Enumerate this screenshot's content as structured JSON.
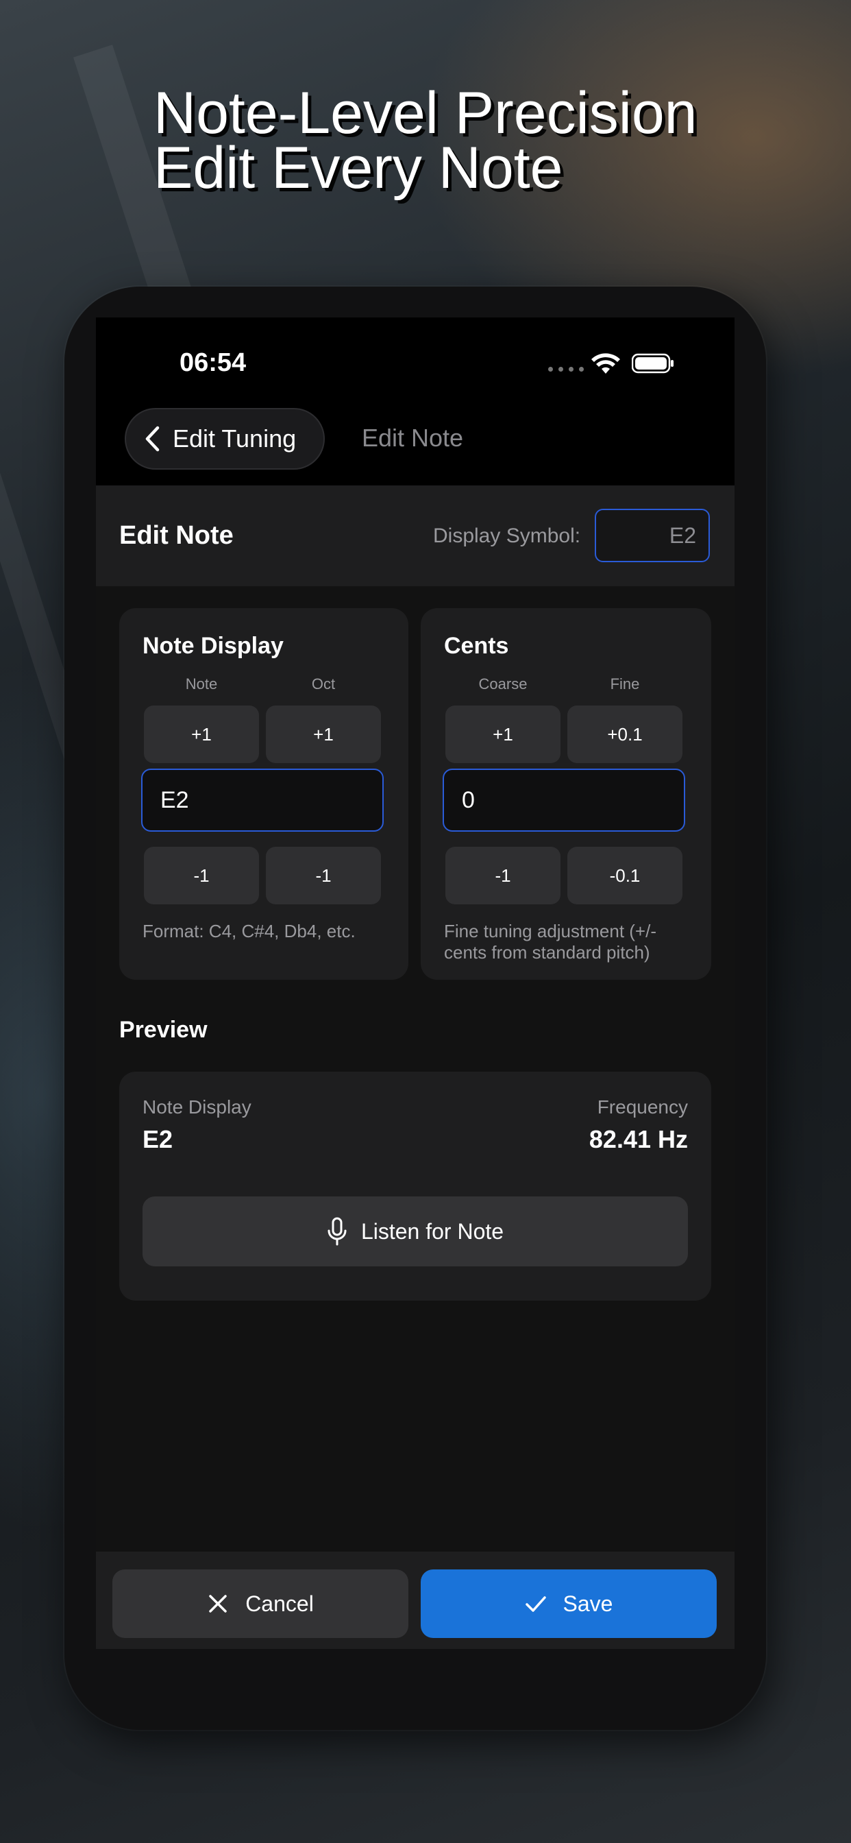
{
  "hero": {
    "line1": "Note-Level Precision",
    "line2": "Edit Every Note"
  },
  "status_bar": {
    "time": "06:54"
  },
  "nav": {
    "back_label": "Edit Tuning",
    "title": "Edit Note"
  },
  "header": {
    "title": "Edit Note",
    "display_symbol_label": "Display Symbol:",
    "display_symbol_placeholder": "E2"
  },
  "note_display": {
    "title": "Note Display",
    "col_note": "Note",
    "col_oct": "Oct",
    "note_plus": "+1",
    "oct_plus": "+1",
    "value": "E2",
    "note_minus": "-1",
    "oct_minus": "-1",
    "help": "Format: C4, C#4, Db4, etc."
  },
  "cents": {
    "title": "Cents",
    "col_coarse": "Coarse",
    "col_fine": "Fine",
    "coarse_plus": "+1",
    "fine_plus": "+0.1",
    "value": "0",
    "coarse_minus": "-1",
    "fine_minus": "-0.1",
    "help": "Fine tuning adjustment (+/- cents from standard pitch)"
  },
  "preview": {
    "section_title": "Preview",
    "note_label": "Note Display",
    "note_value": "E2",
    "freq_label": "Frequency",
    "freq_value": "82.41 Hz",
    "listen_label": "Listen for Note"
  },
  "actions": {
    "cancel_label": "Cancel",
    "save_label": "Save"
  },
  "colors": {
    "accent": "#1a73d9",
    "focus_border": "#2a5bd7"
  },
  "icons": {
    "back": "chevron-left-icon",
    "mic": "microphone-icon",
    "cancel": "close-icon",
    "save": "checkmark-icon",
    "wifi": "wifi-icon",
    "battery": "battery-icon"
  }
}
